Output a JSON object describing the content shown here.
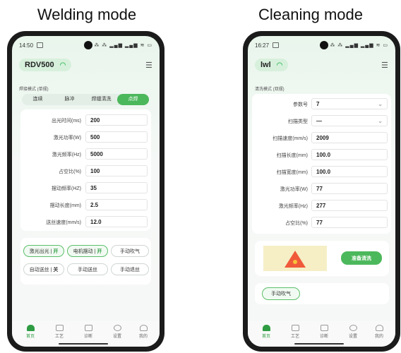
{
  "captions": {
    "left": "Welding mode",
    "right": "Cleaning mode"
  },
  "welding": {
    "status": {
      "time": "14:50",
      "icons": "⁂ ⁂ ▂▄▆ ▂▄▆ ≋ ▭"
    },
    "device_name": "RDV500",
    "mode_label": "焊接模式 (单摆)",
    "tabs": [
      "连续",
      "脉冲",
      "焊缝清洗",
      "点焊"
    ],
    "params": [
      {
        "label": "出光时间(ms)",
        "value": "200"
      },
      {
        "label": "激光功率(W)",
        "value": "500"
      },
      {
        "label": "激光频率(Hz)",
        "value": "5000"
      },
      {
        "label": "占空比(%)",
        "value": "100"
      },
      {
        "label": "摆动频率(HZ)",
        "value": "35"
      },
      {
        "label": "摆动长度(mm)",
        "value": "2.5"
      },
      {
        "label": "送丝速度(mm/s)",
        "value": "12.0"
      }
    ],
    "buttons": {
      "laser": {
        "label": "激光出光",
        "state": "开"
      },
      "motor": {
        "label": "电机摆动",
        "state": "开"
      },
      "blow": "手动吹气",
      "autofeed": {
        "label": "自动送丝",
        "state": "关"
      },
      "manual_feed": "手动送丝",
      "manual_return": "手动退丝"
    }
  },
  "cleaning": {
    "status": {
      "time": "16:27",
      "icons": "⁂ ⁂ ▂▄▆ ▂▄▆ ≋ ▭"
    },
    "device_name": "lwl",
    "mode_label": "清洗模式 (双摆)",
    "params": [
      {
        "label": "参数号",
        "value": "7"
      },
      {
        "label": "扫描类型",
        "value": "—"
      },
      {
        "label": "扫描速度(mm/s)",
        "value": "2009"
      },
      {
        "label": "扫描长度(mm)",
        "value": "100.0"
      },
      {
        "label": "扫描宽度(mm)",
        "value": "100.0"
      },
      {
        "label": "激光功率(W)",
        "value": "77"
      },
      {
        "label": "激光频率(Hz)",
        "value": "277"
      },
      {
        "label": "占空比(%)",
        "value": "77"
      }
    ],
    "ready_button": "准备清洗",
    "blow_button": "手动吹气"
  },
  "nav": [
    "首页",
    "工艺",
    "诊断",
    "设置",
    "我的"
  ],
  "colors": {
    "accent": "#4cb85c",
    "warning": "#f05a3a",
    "warning_bg": "#f6efc6"
  }
}
